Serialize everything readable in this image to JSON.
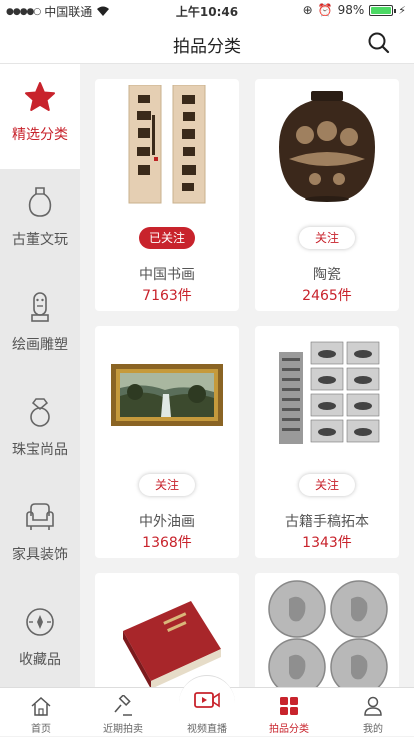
{
  "status": {
    "carrier": "中国联通",
    "time": "上午10:46",
    "battery_pct": "98%",
    "battery_level": 0.98
  },
  "header": {
    "title": "拍品分类"
  },
  "sidebar": {
    "items": [
      {
        "label": "精选分类",
        "icon": "star-icon",
        "active": true
      },
      {
        "label": "古董文玩",
        "icon": "vase-icon"
      },
      {
        "label": "绘画雕塑",
        "icon": "statue-icon"
      },
      {
        "label": "珠宝尚品",
        "icon": "ring-icon"
      },
      {
        "label": "家具装饰",
        "icon": "armchair-icon"
      },
      {
        "label": "收藏品",
        "icon": "collectible-icon"
      }
    ]
  },
  "categories": [
    {
      "name": "中国书画",
      "count": "7163件",
      "follow": "已关注",
      "followed": true
    },
    {
      "name": "陶瓷",
      "count": "2465件",
      "follow": "关注",
      "followed": false
    },
    {
      "name": "中外油画",
      "count": "1368件",
      "follow": "关注",
      "followed": false
    },
    {
      "name": "古籍手稿拓本",
      "count": "1343件",
      "follow": "关注",
      "followed": false
    }
  ],
  "tabs": [
    {
      "label": "首页",
      "icon": "home-icon"
    },
    {
      "label": "近期拍卖",
      "icon": "gavel-icon"
    },
    {
      "label": "视频直播",
      "icon": "video-icon"
    },
    {
      "label": "拍品分类",
      "icon": "grid-icon",
      "active": true
    },
    {
      "label": "我的",
      "icon": "user-icon"
    }
  ],
  "colors": {
    "accent": "#c8232c",
    "sidebar_bg": "#e9e9e9",
    "page_bg": "#f2f2f2"
  }
}
